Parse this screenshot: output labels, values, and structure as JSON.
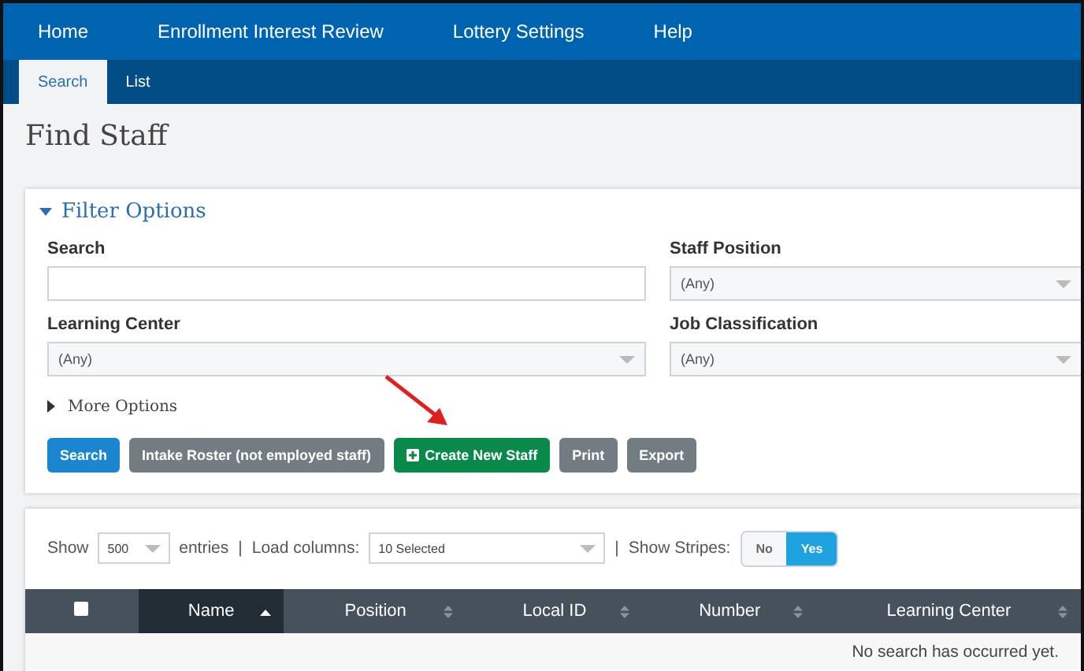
{
  "nav": {
    "items": [
      {
        "label": "Home"
      },
      {
        "label": "Enrollment Interest Review"
      },
      {
        "label": "Lottery Settings"
      },
      {
        "label": "Help"
      }
    ]
  },
  "subnav": {
    "tabs": [
      {
        "label": "Search",
        "selected": true
      },
      {
        "label": "List",
        "selected": false
      }
    ]
  },
  "page_title": "Find Staff",
  "filter": {
    "title": "Filter Options",
    "expanded": true,
    "fields": [
      {
        "kind": "text",
        "label": "Search"
      },
      {
        "kind": "select",
        "label": "Staff Position",
        "value": "(Any)"
      },
      {
        "kind": "select",
        "label": "Learning Center",
        "value": "(Any)"
      },
      {
        "kind": "select",
        "label": "Job Classification",
        "value": "(Any)"
      }
    ],
    "more_options": {
      "label": "More Options",
      "expanded": false
    },
    "buttons": [
      {
        "label": "Search",
        "kind": "primary"
      },
      {
        "label": "Intake Roster (not employed staff)",
        "kind": "secondary"
      },
      {
        "label": "Create New Staff",
        "kind": "create"
      },
      {
        "label": "Print",
        "kind": "secondary"
      },
      {
        "label": "Export",
        "kind": "secondary"
      }
    ]
  },
  "table_controls": {
    "show_label": "Show",
    "page_size": "500",
    "entries_label": "entries",
    "separator_1": "|",
    "load_columns_label": "Load columns:",
    "load_columns_value": "10 Selected",
    "separator_2": "|",
    "stripes_label": "Show Stripes:",
    "stripes_options": [
      {
        "label": "No",
        "selected": false
      },
      {
        "label": "Yes",
        "selected": true
      }
    ]
  },
  "table": {
    "select_all": {
      "checked": false
    },
    "columns": [
      {
        "label": "Name",
        "sorted": true
      },
      {
        "label": "Position",
        "sorted": false
      },
      {
        "label": "Local ID",
        "sorted": false
      },
      {
        "label": "Number",
        "sorted": false
      },
      {
        "label": "Learning Center",
        "sorted": false
      }
    ],
    "empty_message": "No search has occurred yet."
  }
}
